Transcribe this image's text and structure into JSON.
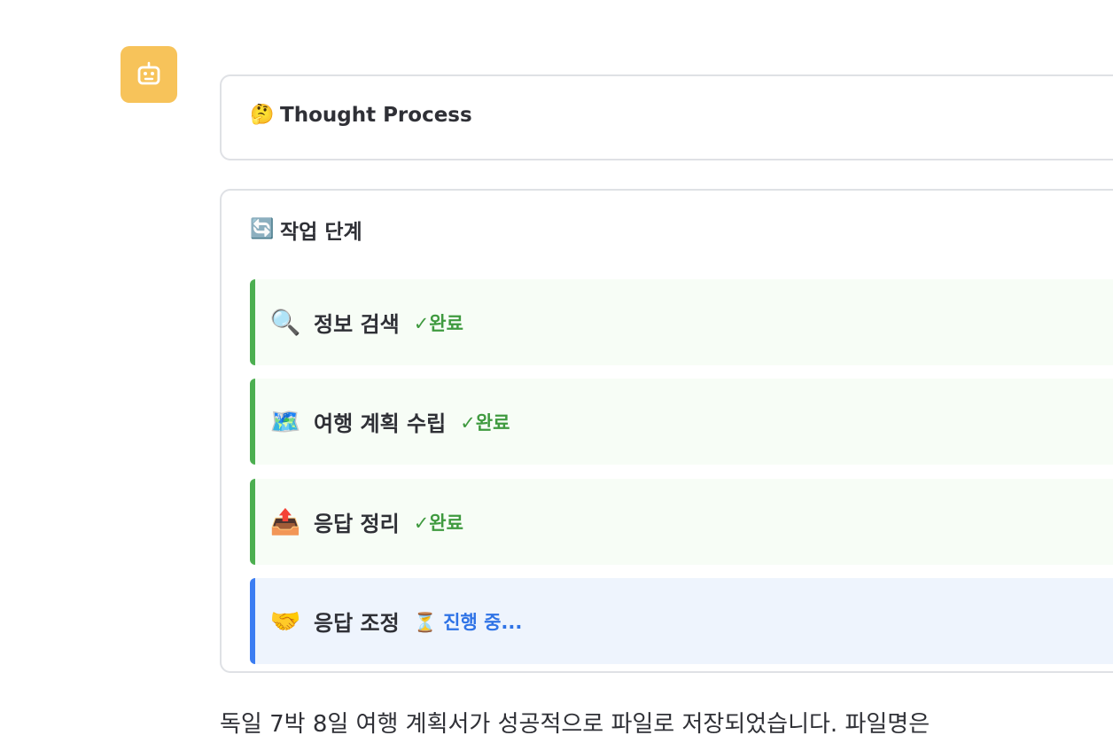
{
  "avatar": {
    "icon": "robot-icon",
    "color": "#f7c35a"
  },
  "thought_process": {
    "icon": "thinking-face-emoji",
    "icon_glyph": "🤔",
    "title": "Thought Process"
  },
  "work_steps": {
    "icon": "counterclockwise-arrows-emoji",
    "icon_glyph": "🔄",
    "title": "작업 단계",
    "steps": [
      {
        "icon": "magnifying-glass-emoji",
        "icon_glyph": "🔍",
        "label": "정보 검색",
        "status": "✓완료",
        "state": "done"
      },
      {
        "icon": "world-map-emoji",
        "icon_glyph": "🗺️",
        "label": "여행 계획 수립",
        "status": "✓완료",
        "state": "done"
      },
      {
        "icon": "outbox-tray-emoji",
        "icon_glyph": "📤",
        "label": "응답 정리",
        "status": "✓완료",
        "state": "done"
      },
      {
        "icon": "handshake-emoji",
        "icon_glyph": "🤝",
        "label": "응답 조정",
        "status_icon": "⏳",
        "status": "진행 중...",
        "state": "in-progress"
      }
    ],
    "colors": {
      "done_accent": "#4caf50",
      "active_accent": "#3b7df2"
    }
  },
  "answer": {
    "text": "독일 7박 8일 여행 계획서가 성공적으로 파일로 저장되었습니다. 파일명은"
  }
}
